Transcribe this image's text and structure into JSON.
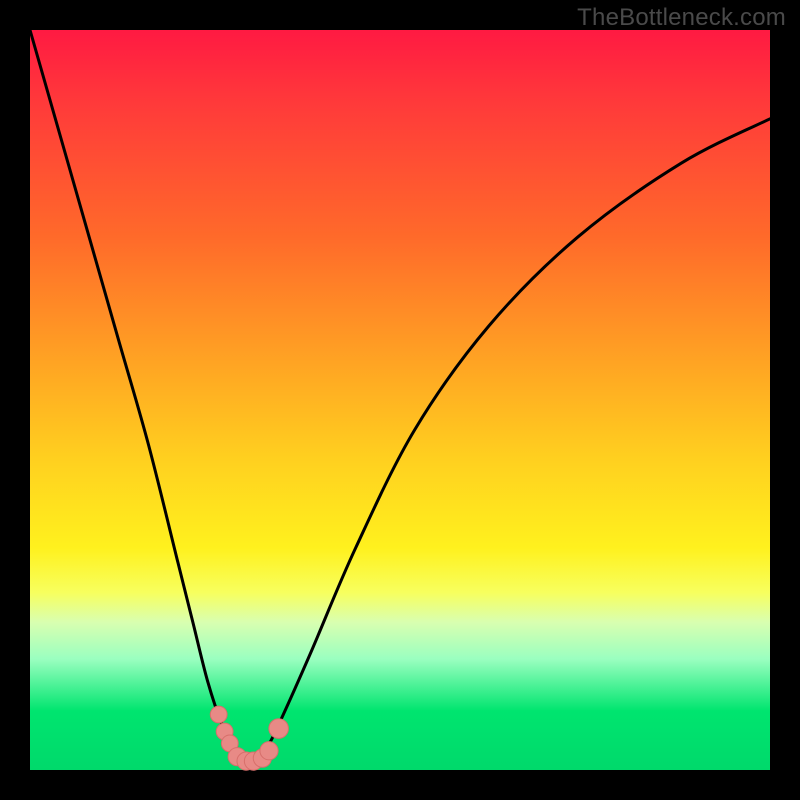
{
  "watermark": "TheBottleneck.com",
  "colors": {
    "frame": "#000000",
    "curve": "#000000",
    "marker_fill": "#e88a86",
    "marker_stroke": "#d76f6b"
  },
  "chart_data": {
    "type": "line",
    "title": "",
    "xlabel": "",
    "ylabel": "",
    "xlim": [
      0,
      100
    ],
    "ylim": [
      0,
      100
    ],
    "grid": false,
    "series": [
      {
        "name": "bottleneck-curve",
        "x": [
          0,
          4,
          8,
          12,
          16,
          20,
          22,
          24,
          26,
          28,
          29,
          30,
          32,
          34,
          38,
          44,
          52,
          62,
          74,
          88,
          100
        ],
        "values": [
          100,
          86,
          72,
          58,
          44,
          28,
          20,
          12,
          6,
          2,
          1,
          1,
          3,
          7,
          16,
          30,
          46,
          60,
          72,
          82,
          88
        ]
      }
    ],
    "markers": [
      {
        "name": "left-cluster-top",
        "x": 25.5,
        "y": 7.5,
        "r": 1.2
      },
      {
        "name": "left-cluster-mid",
        "x": 26.3,
        "y": 5.2,
        "r": 1.2
      },
      {
        "name": "left-cluster-low",
        "x": 27.0,
        "y": 3.6,
        "r": 1.2
      },
      {
        "name": "bottom-1",
        "x": 28.0,
        "y": 1.8,
        "r": 1.3
      },
      {
        "name": "bottom-2",
        "x": 29.2,
        "y": 1.2,
        "r": 1.3
      },
      {
        "name": "bottom-3",
        "x": 30.2,
        "y": 1.2,
        "r": 1.3
      },
      {
        "name": "bottom-4",
        "x": 31.4,
        "y": 1.6,
        "r": 1.3
      },
      {
        "name": "right-cluster-low",
        "x": 32.3,
        "y": 2.6,
        "r": 1.3
      },
      {
        "name": "right-cluster-gap",
        "x": 33.6,
        "y": 5.6,
        "r": 1.4
      }
    ],
    "background_gradient": {
      "top": "#ff1a42",
      "mid": "#ffe11e",
      "bottom": "#00d96b"
    }
  }
}
